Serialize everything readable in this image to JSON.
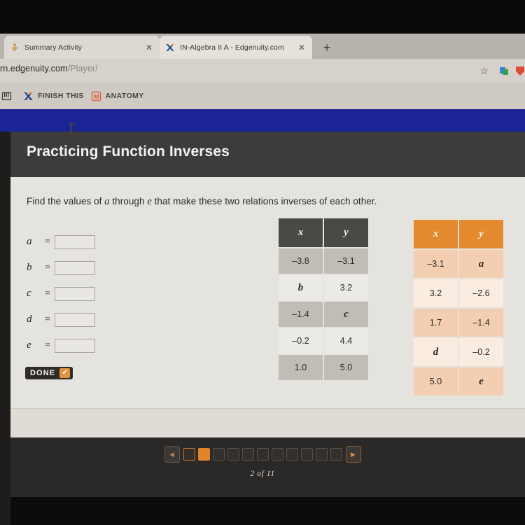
{
  "browser": {
    "tabs": [
      {
        "title": "Summary Activity",
        "favicon": "person-figure-icon",
        "close_label": "✕"
      },
      {
        "title": "IN-Algebra II A - Edgenuity.com",
        "favicon": "edgenuity-x-icon",
        "close_label": "✕"
      }
    ],
    "new_tab_label": "+",
    "url_host": "rn.edgenuity.com",
    "url_path": "/Player/",
    "star_icon": "☆",
    "bookmarks": [
      {
        "label": "",
        "icon": "piano-keys-icon"
      },
      {
        "label": "FINISH THIS",
        "icon": "edgenuity-x-icon"
      },
      {
        "label": "ANATOMY",
        "icon": "m-letter-icon"
      }
    ]
  },
  "app": {
    "title": "Practicing Function Inverses",
    "prompt_pre": "Find the values of ",
    "prompt_var1": "a",
    "prompt_mid": " through ",
    "prompt_var2": "e",
    "prompt_post": " that make these two relations inverses of each other.",
    "fields": [
      {
        "label": "a",
        "eq": "=",
        "value": "",
        "placeholder": ""
      },
      {
        "label": "b",
        "eq": "=",
        "value": "",
        "placeholder": ""
      },
      {
        "label": "c",
        "eq": "=",
        "value": "",
        "placeholder": ""
      },
      {
        "label": "d",
        "eq": "=",
        "value": "",
        "placeholder": ""
      },
      {
        "label": "e",
        "eq": "=",
        "value": "",
        "placeholder": ""
      }
    ],
    "done_label": "DONE",
    "done_check": "✔"
  },
  "chart_data": [
    {
      "type": "table",
      "title": "relation-1",
      "columns": [
        "x",
        "y"
      ],
      "rows": [
        [
          "–3.8",
          "–3.1"
        ],
        [
          "b",
          "3.2"
        ],
        [
          "–1.4",
          "c"
        ],
        [
          "–0.2",
          "4.4"
        ],
        [
          "1.0",
          "5.0"
        ]
      ],
      "variable_cells": [
        [
          1,
          0
        ],
        [
          2,
          1
        ]
      ],
      "header_color": "#4b4945",
      "row_colors": [
        "#c0bdb6",
        "#eceae4"
      ]
    },
    {
      "type": "table",
      "title": "relation-2",
      "columns": [
        "x",
        "y"
      ],
      "rows": [
        [
          "–3.1",
          "a"
        ],
        [
          "3.2",
          "–2.6"
        ],
        [
          "1.7",
          "–1.4"
        ],
        [
          "d",
          "–0.2"
        ],
        [
          "5.0",
          "e"
        ]
      ],
      "variable_cells": [
        [
          0,
          1
        ],
        [
          3,
          0
        ],
        [
          4,
          1
        ]
      ],
      "header_color": "#e28a2d",
      "row_colors": [
        "#f3ceb0",
        "#faece0"
      ]
    }
  ],
  "nav": {
    "prev_label": "◀",
    "next_label": "▶",
    "page_label": "2 of 11",
    "total_dots": 11,
    "current_index": 2,
    "seen_index": 1,
    "accent_color": "#e2822a"
  }
}
